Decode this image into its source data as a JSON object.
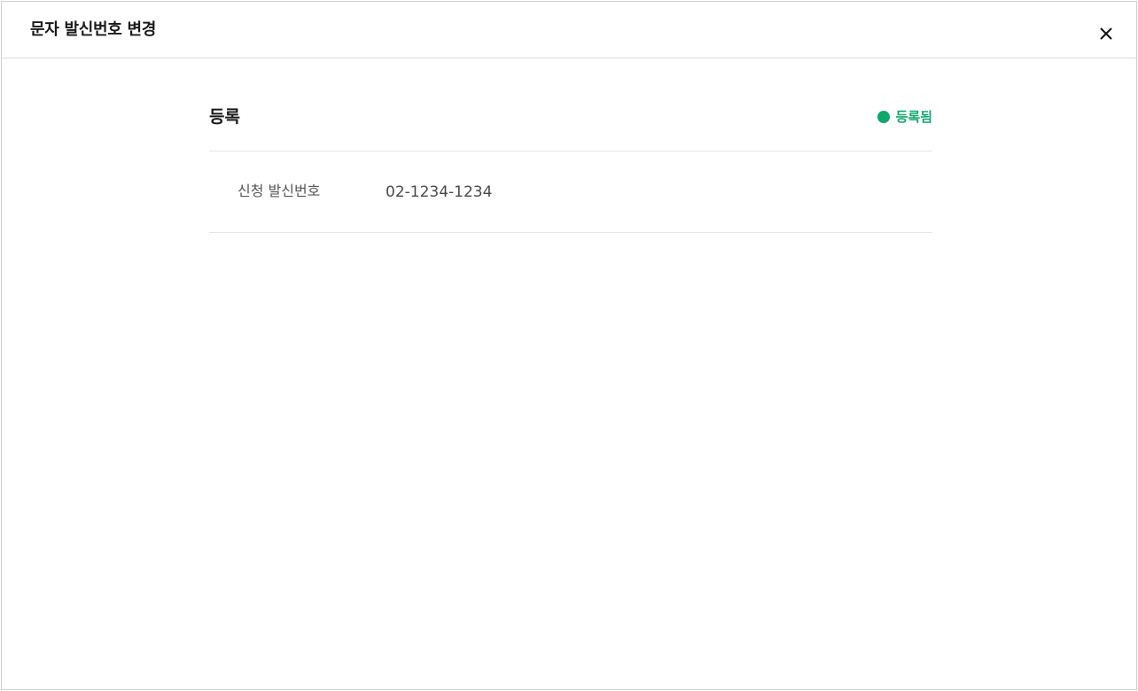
{
  "dialog": {
    "title": "문자 발신번호 변경",
    "close_icon": "close-icon"
  },
  "section": {
    "title": "등록",
    "status": {
      "label": "등록됨",
      "color": "#0ea86b"
    },
    "rows": [
      {
        "label": "신청 발신번호",
        "value": "02-1234-1234"
      }
    ]
  }
}
